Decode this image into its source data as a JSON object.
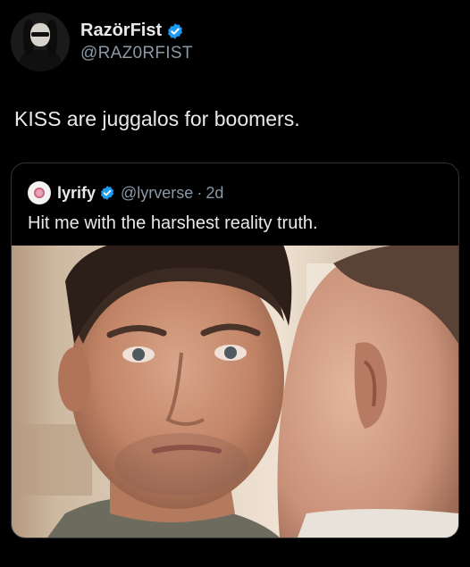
{
  "author": {
    "display_name": "RazörFist",
    "handle": "@RAZ0RFIST",
    "verified": true,
    "avatar_icon": "profile-avatar"
  },
  "post": {
    "text": "KISS are juggalos for boomers."
  },
  "quoted_post": {
    "display_name": "lyrify",
    "handle": "@lyrverse",
    "separator": "·",
    "time": "2d",
    "verified": true,
    "text": "Hit me with the harshest reality truth.",
    "media_icon": "photo-media"
  },
  "colors": {
    "background": "#000000",
    "text": "#e7e9ea",
    "secondary_text": "#8b98a5",
    "verified_blue": "#1d9bf0",
    "border": "#2f3336"
  }
}
